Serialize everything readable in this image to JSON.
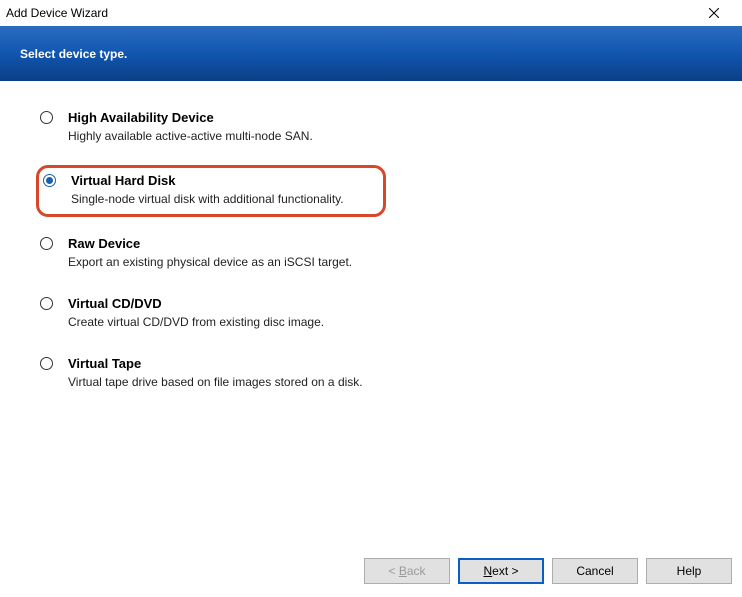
{
  "window": {
    "title": "Add Device Wizard"
  },
  "header": {
    "title": "Select device type."
  },
  "options": [
    {
      "title": "High Availability Device",
      "desc": "Highly available active-active multi-node SAN.",
      "selected": false,
      "highlighted": false
    },
    {
      "title": "Virtual Hard Disk",
      "desc": "Single-node virtual disk with additional functionality.",
      "selected": true,
      "highlighted": true
    },
    {
      "title": "Raw Device",
      "desc": "Export an existing physical device as an iSCSI target.",
      "selected": false,
      "highlighted": false
    },
    {
      "title": "Virtual CD/DVD",
      "desc": "Create virtual CD/DVD from existing disc image.",
      "selected": false,
      "highlighted": false
    },
    {
      "title": "Virtual Tape",
      "desc": "Virtual tape drive based on file images stored on a disk.",
      "selected": false,
      "highlighted": false
    }
  ],
  "buttons": {
    "back_prefix": "< ",
    "back_u": "B",
    "back_rest": "ack",
    "next_u": "N",
    "next_rest": "ext >",
    "cancel": "Cancel",
    "help": "Help"
  }
}
